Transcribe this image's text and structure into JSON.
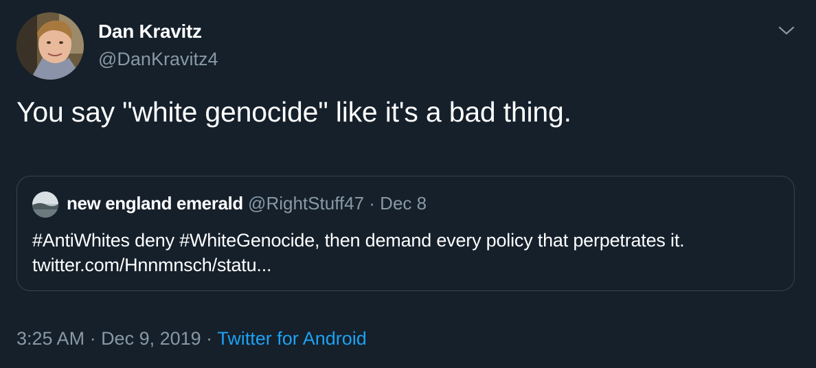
{
  "author": {
    "display_name": "Dan Kravitz",
    "handle": "@DanKravitz4"
  },
  "tweet": {
    "text": "You say \"white genocide\" like it's a bad thing."
  },
  "quoted_tweet": {
    "display_name": "new england emerald",
    "handle": "@RightStuff47",
    "separator": " · ",
    "date": "Dec 8",
    "line1": "#AntiWhites deny #WhiteGenocide, then demand every policy that perpetrates it.",
    "line2": "twitter.com/Hnnmnsch/statu..."
  },
  "meta": {
    "time": "3:25 AM",
    "separator1": " · ",
    "date": "Dec 9, 2019",
    "separator2": " · ",
    "source": "Twitter for Android"
  },
  "icons": {
    "menu": "chevron-down-icon"
  },
  "colors": {
    "background": "#15202b",
    "secondary_text": "#8899a6",
    "link": "#1da1f2",
    "border": "#38444d"
  }
}
